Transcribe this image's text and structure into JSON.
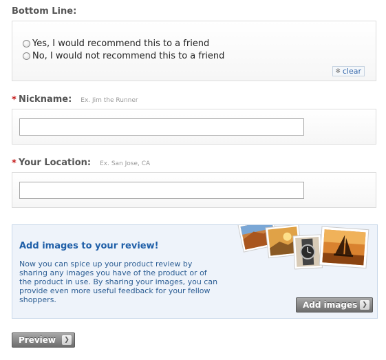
{
  "bottom_line": {
    "label": "Bottom Line:",
    "options": [
      {
        "label": "Yes, I would recommend this to a friend"
      },
      {
        "label": "No, I would not recommend this to a friend"
      }
    ],
    "clear_label": "clear"
  },
  "nickname": {
    "required_marker": "*",
    "label": "Nickname:",
    "example": "Ex. Jim the Runner",
    "value": ""
  },
  "location": {
    "required_marker": "*",
    "label": "Your Location:",
    "example": "Ex. San Jose, CA",
    "value": ""
  },
  "images_promo": {
    "title": "Add images to your review!",
    "body": "Now you can spice up your product review by sharing any images you have of the product or of the product in use. By sharing your images, you can provide even more useful feedback for your fellow shoppers.",
    "button_label": "Add images"
  },
  "preview_label": "Preview",
  "colors": {
    "required": "#c41818",
    "promo_title": "#1f5fa8",
    "promo_text": "#2b5d93",
    "button_gray": "#888888"
  }
}
